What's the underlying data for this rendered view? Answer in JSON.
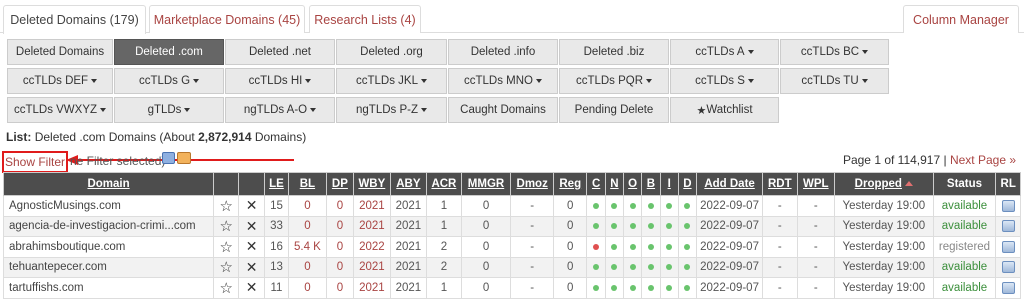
{
  "tabs": [
    {
      "label": "Deleted Domains (179)"
    },
    {
      "label": "Marketplace Domains (45)"
    },
    {
      "label": "Research Lists (4)"
    }
  ],
  "column_manager": "Column Manager",
  "filters": [
    [
      "Deleted Domains",
      "Deleted .com",
      "Deleted .net",
      "Deleted .org",
      "Deleted .info",
      "Deleted .biz",
      "ccTLDs A",
      "ccTLDs BC"
    ],
    [
      "ccTLDs DEF",
      "ccTLDs G",
      "ccTLDs HI",
      "ccTLDs JKL",
      "ccTLDs MNO",
      "ccTLDs PQR",
      "ccTLDs S",
      "ccTLDs TU"
    ],
    [
      "ccTLDs VWXYZ",
      "gTLDs",
      "ngTLDs A-O",
      "ngTLDs P-Z",
      "Caught Domains",
      "Pending Delete",
      "Watchlist"
    ]
  ],
  "watchlist_star": "★",
  "list": {
    "prefix": "List:",
    "name": "Deleted .com Domains (About",
    "count": "2,872,914",
    "suffix": "Domains)"
  },
  "show_filter": "Show Filter",
  "no_filter": "ne Filter selected)",
  "pagination": {
    "text": "Page 1 of 114,917 |",
    "next": "Next Page »"
  },
  "colors": {
    "accent": "#a94442",
    "header_bg": "#4d4d4d",
    "active_filter": "#666666",
    "annotation_red": "#e01b1b",
    "dot_green": "#69c46d",
    "dot_red": "#e05050"
  },
  "table": {
    "headers": [
      "Domain",
      "",
      "",
      "LE",
      "BL",
      "DP",
      "WBY",
      "ABY",
      "ACR",
      "MMGR",
      "Dmoz",
      "Reg",
      "C",
      "N",
      "O",
      "B",
      "I",
      "D",
      "Add Date",
      "RDT",
      "WPL",
      "Dropped",
      "Status",
      "RL"
    ],
    "rows": [
      {
        "domain": "AgnosticMusings.com",
        "le": "15",
        "bl": "0",
        "dp": "0",
        "wby": "2021",
        "aby": "2021",
        "acr": "1",
        "mmgr": "0",
        "dmoz": "-",
        "reg": "0",
        "dots": [
          "g",
          "g",
          "g",
          "g",
          "g",
          "g"
        ],
        "add": "2022-09-07",
        "rdt": "-",
        "wpl": "-",
        "dropped": "Yesterday 19:00",
        "status": "available"
      },
      {
        "domain": "agencia-de-investigacion-crimi...com",
        "le": "33",
        "bl": "0",
        "dp": "0",
        "wby": "2021",
        "aby": "2021",
        "acr": "1",
        "mmgr": "0",
        "dmoz": "-",
        "reg": "0",
        "dots": [
          "g",
          "g",
          "g",
          "g",
          "g",
          "g"
        ],
        "add": "2022-09-07",
        "rdt": "-",
        "wpl": "-",
        "dropped": "Yesterday 19:00",
        "status": "available"
      },
      {
        "domain": "abrahimsboutique.com",
        "le": "16",
        "bl": "5.4 K",
        "dp": "0",
        "wby": "2022",
        "aby": "2021",
        "acr": "2",
        "mmgr": "0",
        "dmoz": "-",
        "reg": "0",
        "dots": [
          "r",
          "g",
          "g",
          "g",
          "g",
          "g"
        ],
        "add": "2022-09-07",
        "rdt": "-",
        "wpl": "-",
        "dropped": "Yesterday 19:00",
        "status": "registered"
      },
      {
        "domain": "tehuantepecer.com",
        "le": "13",
        "bl": "0",
        "dp": "0",
        "wby": "2021",
        "aby": "2021",
        "acr": "2",
        "mmgr": "0",
        "dmoz": "-",
        "reg": "0",
        "dots": [
          "g",
          "g",
          "g",
          "g",
          "g",
          "g"
        ],
        "add": "2022-09-07",
        "rdt": "-",
        "wpl": "-",
        "dropped": "Yesterday 19:00",
        "status": "available"
      },
      {
        "domain": "tartuffishs.com",
        "le": "11",
        "bl": "0",
        "dp": "0",
        "wby": "2021",
        "aby": "2021",
        "acr": "1",
        "mmgr": "0",
        "dmoz": "-",
        "reg": "0",
        "dots": [
          "g",
          "g",
          "g",
          "g",
          "g",
          "g"
        ],
        "add": "2022-09-07",
        "rdt": "-",
        "wpl": "-",
        "dropped": "Yesterday 19:00",
        "status": "available"
      }
    ]
  }
}
